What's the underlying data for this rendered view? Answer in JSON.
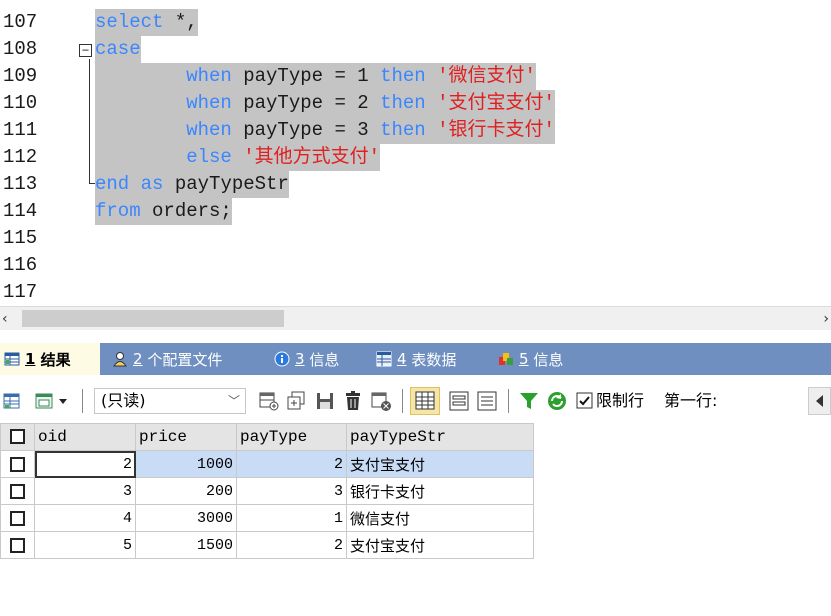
{
  "editor": {
    "line_numbers": [
      "107",
      "108",
      "109",
      "110",
      "111",
      "112",
      "113",
      "114",
      "115",
      "116",
      "117"
    ],
    "lines": [
      [
        {
          "t": "select",
          "c": "kw"
        },
        {
          "t": " *,",
          "c": "tx"
        }
      ],
      [
        {
          "t": "case",
          "c": "kw"
        }
      ],
      [
        {
          "t": "        ",
          "c": "tx"
        },
        {
          "t": "when",
          "c": "kw"
        },
        {
          "t": " payType = 1 ",
          "c": "tx"
        },
        {
          "t": "then",
          "c": "kw"
        },
        {
          "t": " '微信支付'",
          "c": "st"
        }
      ],
      [
        {
          "t": "        ",
          "c": "tx"
        },
        {
          "t": "when",
          "c": "kw"
        },
        {
          "t": " payType = 2 ",
          "c": "tx"
        },
        {
          "t": "then",
          "c": "kw"
        },
        {
          "t": " '支付宝支付'",
          "c": "st"
        }
      ],
      [
        {
          "t": "        ",
          "c": "tx"
        },
        {
          "t": "when",
          "c": "kw"
        },
        {
          "t": " payType = 3 ",
          "c": "tx"
        },
        {
          "t": "then",
          "c": "kw"
        },
        {
          "t": " '银行卡支付'",
          "c": "st"
        }
      ],
      [
        {
          "t": "        ",
          "c": "tx"
        },
        {
          "t": "else",
          "c": "kw"
        },
        {
          "t": " '其他方式支付'",
          "c": "st"
        }
      ],
      [
        {
          "t": "end",
          "c": "kw"
        },
        {
          "t": " ",
          "c": "tx"
        },
        {
          "t": "as",
          "c": "kw"
        },
        {
          "t": " payTypeStr",
          "c": "tx"
        }
      ],
      [
        {
          "t": "from",
          "c": "kw"
        },
        {
          "t": " orders;",
          "c": "tx"
        }
      ]
    ],
    "fold_symbol": "−",
    "selection_color": "#c4c4c4",
    "keyword_color": "#3b86ff",
    "string_color": "#e02020"
  },
  "scrollbar": {
    "left_arrow": "‹",
    "right_arrow": "›"
  },
  "tabs": [
    {
      "num": "1",
      "label": "结果",
      "icon": "table-grid-icon",
      "active": true
    },
    {
      "num": "2",
      "label": "个配置文件",
      "icon": "profile-icon",
      "active": false
    },
    {
      "num": "3",
      "label": "信息",
      "icon": "info-icon",
      "active": false
    },
    {
      "num": "4",
      "label": "表数据",
      "icon": "table-data-icon",
      "active": false
    },
    {
      "num": "5",
      "label": "信息",
      "icon": "info-colored-icon",
      "active": false
    }
  ],
  "toolbar": {
    "readonly_select": "(只读)",
    "limit_rows_label": "限制行",
    "limit_rows_checked": true,
    "first_row_label": "第一行:"
  },
  "grid": {
    "columns": [
      "oid",
      "price",
      "payType",
      "payTypeStr"
    ],
    "rows": [
      {
        "oid": "2",
        "price": "1000",
        "payType": "2",
        "payTypeStr": "支付宝支付"
      },
      {
        "oid": "3",
        "price": "200",
        "payType": "3",
        "payTypeStr": "银行卡支付"
      },
      {
        "oid": "4",
        "price": "3000",
        "payType": "1",
        "payTypeStr": "微信支付"
      },
      {
        "oid": "5",
        "price": "1500",
        "payType": "2",
        "payTypeStr": "支付宝支付"
      }
    ],
    "selected_row": 0
  },
  "colors": {
    "tabbar": "#6e8fc0",
    "active_tab": "#fdfbe4",
    "selected_row": "#c8dcf6"
  }
}
